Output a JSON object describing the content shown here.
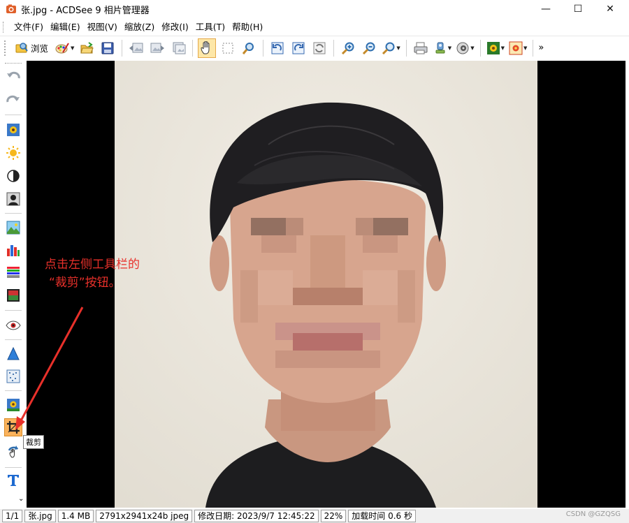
{
  "window": {
    "title": "张.jpg - ACDSee 9 相片管理器",
    "minimize_glyph": "—",
    "maximize_glyph": "☐",
    "close_glyph": "✕"
  },
  "menu": {
    "items": [
      "文件(F)",
      "编辑(E)",
      "视图(V)",
      "缩放(Z)",
      "修改(I)",
      "工具(T)",
      "帮助(H)"
    ]
  },
  "toolbar": {
    "browse_label": "浏览",
    "overflow_glyph": "»",
    "buttons": [
      "browse-icon",
      "edit-palette-icon",
      "open-folder-icon",
      "save-disk-icon",
      "previous-image-icon",
      "next-image-icon",
      "auto-advance-icon",
      "hand-pan-icon",
      "select-region-icon",
      "magnify-icon",
      "rotate-left-icon",
      "rotate-right-icon",
      "flip-icon",
      "zoom-in-icon",
      "zoom-out-icon",
      "zoom-actual-icon",
      "print-icon",
      "acquire-icon",
      "audio-icon",
      "wallpaper-icon",
      "slideshow-icon"
    ]
  },
  "left_toolbar": {
    "tools": [
      "undo-icon",
      "redo-icon",
      "image-adjust-icon",
      "brightness-icon",
      "contrast-icon",
      "portrait-icon",
      "landscape-icon",
      "histogram-icon",
      "levels-icon",
      "color-balance-icon",
      "red-eye-icon",
      "sharpen-icon",
      "noise-icon",
      "effects-icon",
      "crop-icon",
      "rotate-tool-icon",
      "text-icon"
    ],
    "scroll_glyph": "⌄"
  },
  "annotation": {
    "line1": "点击左侧工具栏的",
    "line2": "“裁剪”按钮。",
    "color": "#e8302a"
  },
  "tooltip": {
    "text": "裁剪"
  },
  "statusbar": {
    "index": "1/1",
    "filename": "张.jpg",
    "filesize": "1.4 MB",
    "dimensions": "2791x2941x24b jpeg",
    "modified": "修改日期: 2023/9/7 12:45:22",
    "zoom": "22%",
    "load_time": "加载时间 0.6 秒",
    "watermark": "CSDN @GZQSG"
  }
}
